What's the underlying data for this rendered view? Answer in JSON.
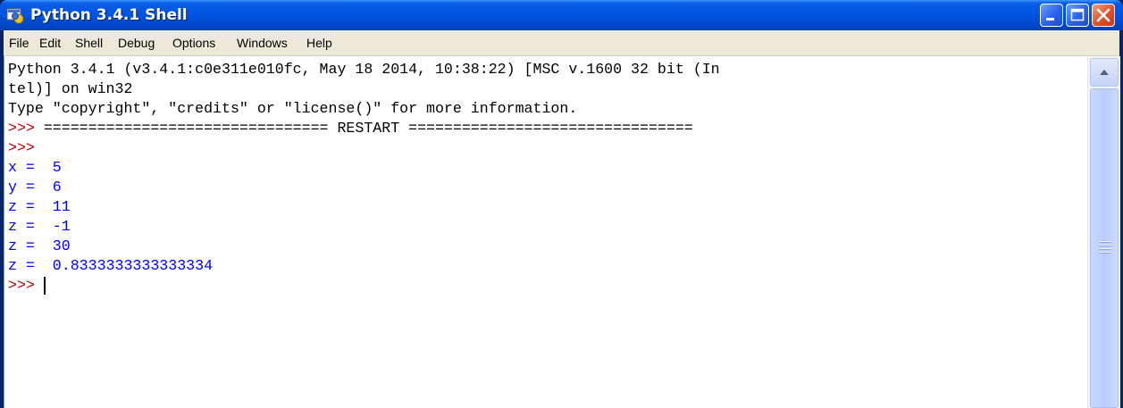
{
  "window": {
    "title": "Python 3.4.1 Shell",
    "icon": "python-shell-icon",
    "controls": [
      "minimize-icon",
      "maximize-icon",
      "close-icon"
    ]
  },
  "menu": {
    "items": [
      {
        "label": "File"
      },
      {
        "label": "Edit"
      },
      {
        "label": "Shell"
      },
      {
        "label": "Debug"
      },
      {
        "label": "Options"
      },
      {
        "label": "Windows"
      },
      {
        "label": "Help"
      }
    ]
  },
  "shell": {
    "banner_line1": "Python 3.4.1 (v3.4.1:c0e311e010fc, May 18 2014, 10:38:22) [MSC v.1600 32 bit (In",
    "banner_line2": "tel)] on win32",
    "banner_line3": "Type \"copyright\", \"credits\" or \"license()\" for more information.",
    "prompt": ">>>",
    "restart_line": " ================================ RESTART ================================",
    "outputs": [
      "x =  5",
      "y =  6",
      "z =  11",
      "z =  -1",
      "z =  30",
      "z =  0.8333333333333334"
    ]
  },
  "colors": {
    "prompt": "#c00000",
    "output": "#0000ff",
    "titlebar": "#0054e3"
  }
}
